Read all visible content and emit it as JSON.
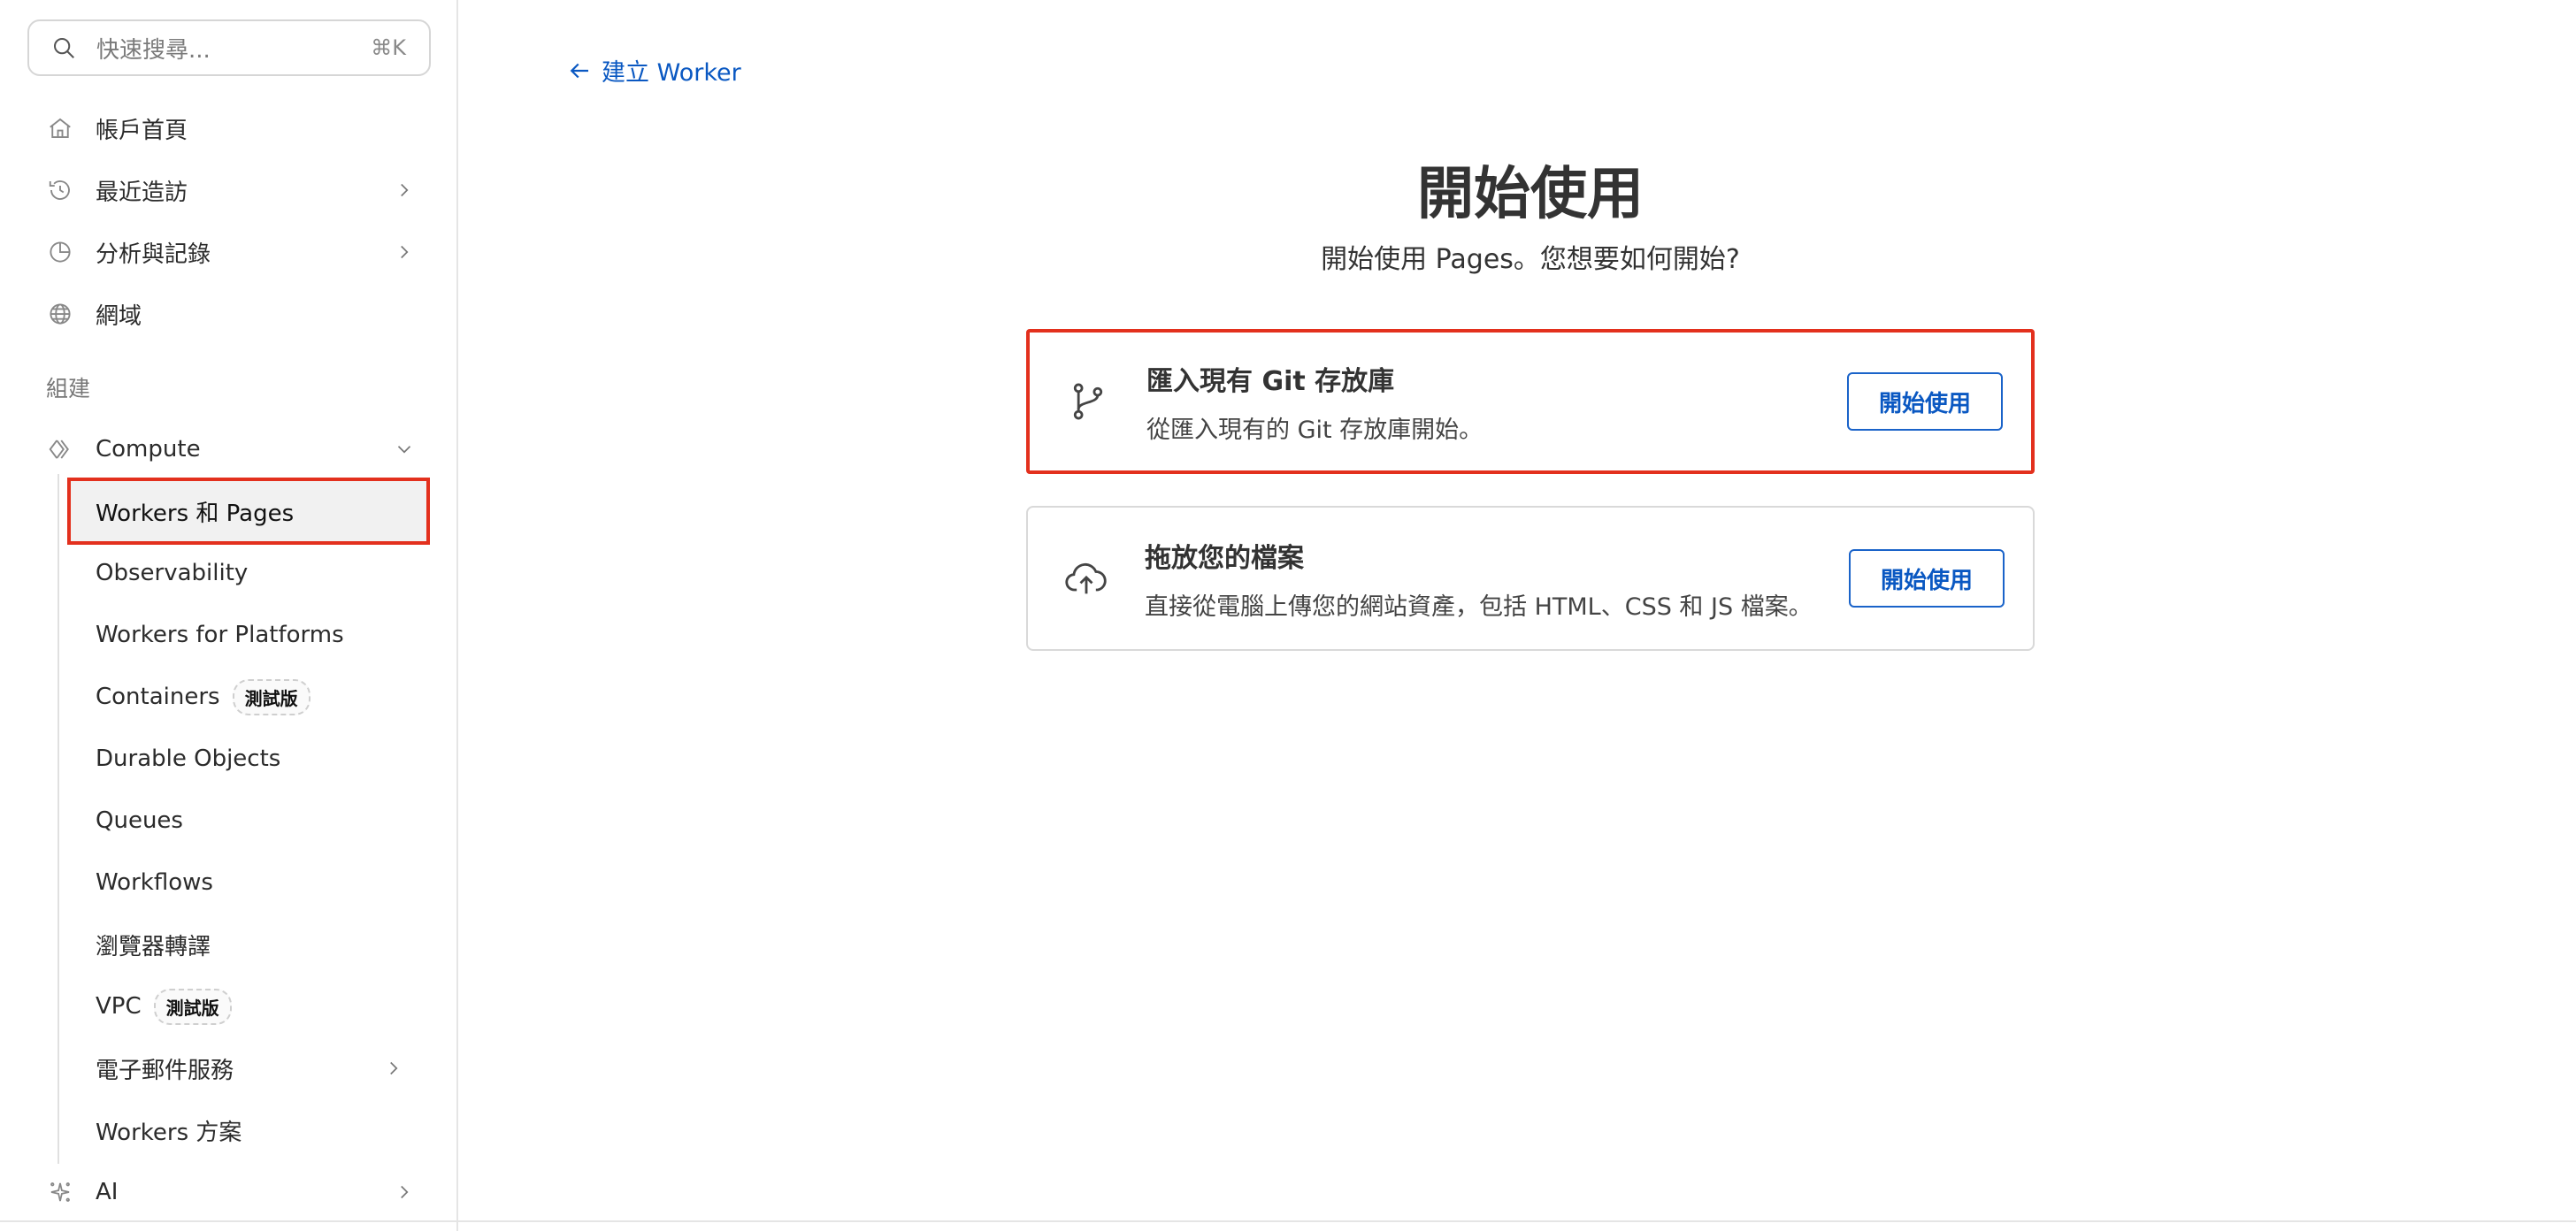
{
  "search": {
    "placeholder": "快速搜尋...",
    "shortcut": "⌘K",
    "icon": "search-icon"
  },
  "sidebar": {
    "top_items": [
      {
        "label": "帳戶首頁",
        "icon": "home-icon",
        "has_chevron": false
      },
      {
        "label": "最近造訪",
        "icon": "history-icon",
        "has_chevron": true
      },
      {
        "label": "分析與記錄",
        "icon": "pie-chart-icon",
        "has_chevron": true
      },
      {
        "label": "網域",
        "icon": "globe-icon",
        "has_chevron": false
      }
    ],
    "section_label": "組建",
    "compute": {
      "label": "Compute",
      "icon": "compute-icon",
      "expanded": true
    },
    "compute_items": [
      {
        "label": "Workers 和 Pages",
        "active": true
      },
      {
        "label": "Observability"
      },
      {
        "label": "Workers for Platforms"
      },
      {
        "label": "Containers",
        "badge": "測試版"
      },
      {
        "label": "Durable Objects"
      },
      {
        "label": "Queues"
      },
      {
        "label": "Workflows"
      },
      {
        "label": "瀏覽器轉譯"
      },
      {
        "label": "VPC",
        "badge": "測試版"
      },
      {
        "label": "電子郵件服務",
        "has_chevron": true
      },
      {
        "label": "Workers 方案"
      }
    ],
    "ai": {
      "label": "AI",
      "icon": "ai-sparkle-icon",
      "has_chevron": true
    }
  },
  "main": {
    "back_link": "建立 Worker",
    "title": "開始使用",
    "subtitle": "開始使用 Pages。您想要如何開始?",
    "cards": [
      {
        "title": "匯入現有 Git 存放庫",
        "description": "從匯入現有的 Git 存放庫開始。",
        "button": "開始使用",
        "icon": "git-branch-icon",
        "highlighted": true
      },
      {
        "title": "拖放您的檔案",
        "description": "直接從電腦上傳您的網站資產，包括 HTML、CSS 和 JS 檔案。",
        "button": "開始使用",
        "icon": "cloud-upload-icon",
        "highlighted": false
      }
    ]
  },
  "colors": {
    "link": "#0a58c2",
    "highlight": "#e3301d",
    "border": "#d9d9d9"
  }
}
